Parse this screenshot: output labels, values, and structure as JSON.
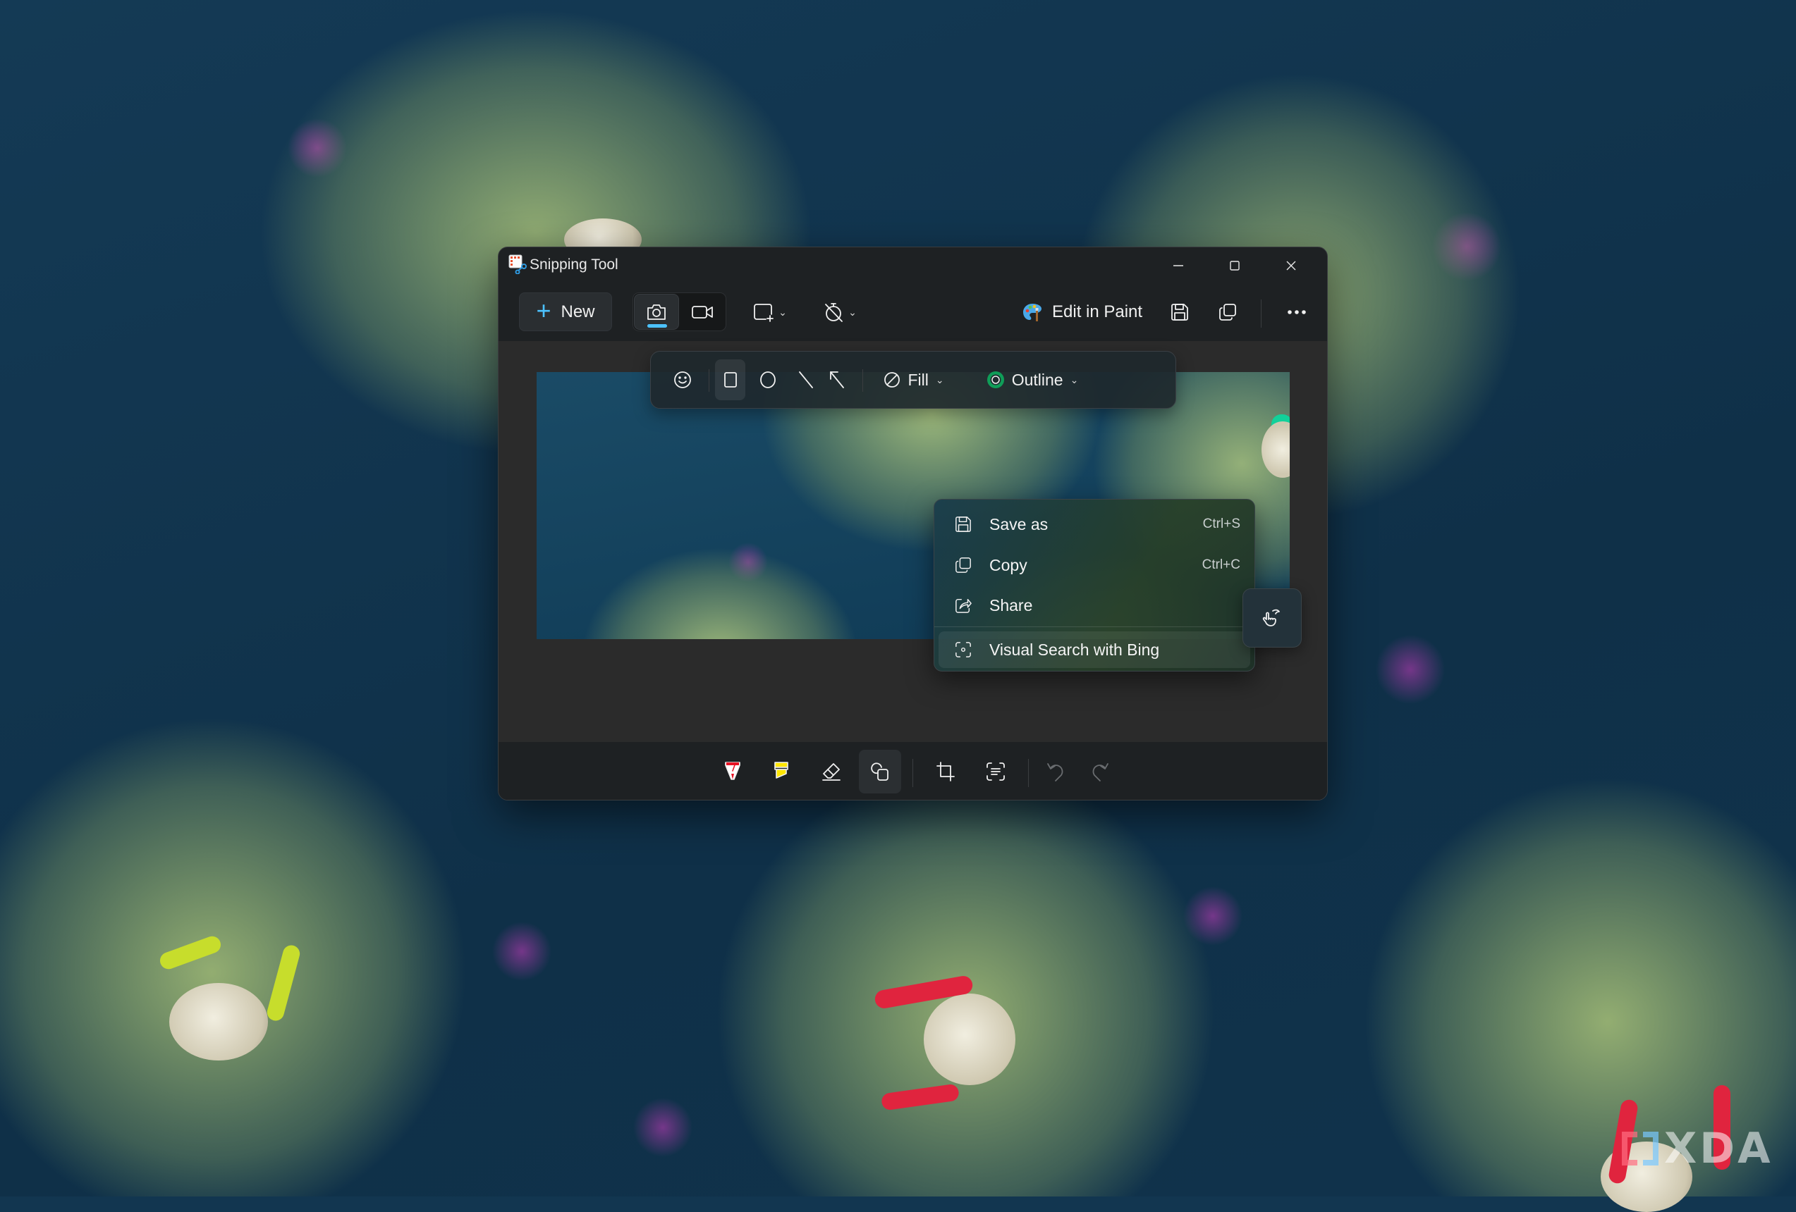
{
  "window": {
    "title": "Snipping Tool",
    "controls": {
      "minimize": "minimize",
      "maximize": "maximize",
      "close": "close"
    }
  },
  "toolbar": {
    "new_label": "New",
    "capture_modes": [
      {
        "icon": "camera-icon",
        "label": "Snip",
        "selected": true
      },
      {
        "icon": "video-icon",
        "label": "Record",
        "selected": false
      }
    ],
    "snip_shape_icon": "rectangle-snip-icon",
    "delay_icon": "no-timer-icon",
    "edit_in_paint_label": "Edit in Paint",
    "save_icon": "save-icon",
    "copy_icon": "copy-icon",
    "more_icon": "more-icon",
    "accent_color": "#4cc2ff"
  },
  "shapes_toolbar": {
    "items": [
      {
        "icon": "emoji-icon"
      },
      {
        "icon": "rectangle-icon",
        "selected": true
      },
      {
        "icon": "ellipse-icon"
      },
      {
        "icon": "line-icon"
      },
      {
        "icon": "arrow-icon"
      }
    ],
    "fill_label": "Fill",
    "outline_label": "Outline",
    "outline_color": "#0f9d58"
  },
  "context_menu": {
    "items": [
      {
        "label": "Save as",
        "shortcut": "Ctrl+S",
        "icon": "save-icon"
      },
      {
        "label": "Copy",
        "shortcut": "Ctrl+C",
        "icon": "copy-icon"
      },
      {
        "label": "Share",
        "shortcut": "",
        "icon": "share-icon"
      },
      {
        "label": "Visual Search with Bing",
        "shortcut": "",
        "icon": "visual-search-icon",
        "highlighted": true
      }
    ]
  },
  "bottom_toolbar": {
    "items": [
      {
        "icon": "ballpoint-pen-icon",
        "color": "#e81224"
      },
      {
        "icon": "highlighter-icon",
        "color": "#ffe600"
      },
      {
        "icon": "eraser-icon"
      },
      {
        "icon": "shapes-icon",
        "selected": true
      },
      {
        "icon": "crop-icon"
      },
      {
        "icon": "text-actions-icon"
      },
      {
        "icon": "undo-icon",
        "disabled": true
      },
      {
        "icon": "redo-icon",
        "disabled": true
      }
    ]
  },
  "watermark": {
    "text": "XDA"
  }
}
